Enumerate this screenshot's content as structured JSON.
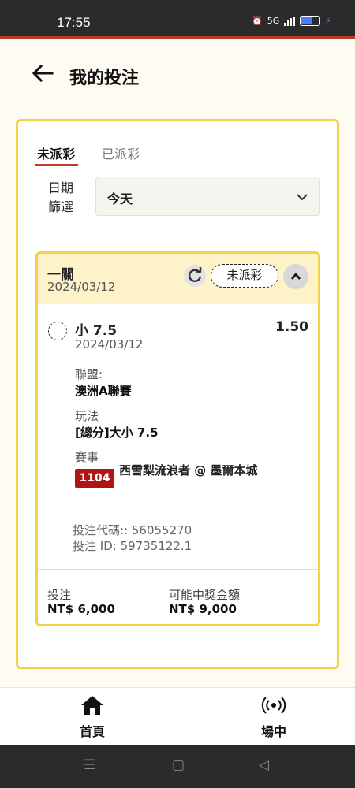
{
  "status_bar": {
    "time": "17:55",
    "network": "5G"
  },
  "header": {
    "title": "我的投注"
  },
  "tabs": [
    {
      "label": "未派彩",
      "active": true
    },
    {
      "label": "已派彩",
      "active": false
    }
  ],
  "filter": {
    "label": "日期篩選",
    "value": "今天"
  },
  "bet": {
    "type": "一關",
    "date": "2024/03/12",
    "status": "未派彩",
    "selection": "小 7.5",
    "odds": "1.50",
    "selection_date": "2024/03/12",
    "league_label": "聯盟:",
    "league": "澳洲A聯賽",
    "market_label": "玩法",
    "market": "[總分]大小 7.5",
    "event_label": "賽事",
    "event_id": "1104",
    "event_name": "西雪梨流浪者 @ 墨爾本城",
    "bet_code": "投注代碼:: 56055270",
    "bet_id": "投注 ID: 59735122.1",
    "stake_label": "投注",
    "stake": "NT$ 6,000",
    "payout_label": "可能中獎金額",
    "payout": "NT$ 9,000"
  },
  "bottom_nav": [
    {
      "label": "首頁",
      "icon": "home-icon"
    },
    {
      "label": "場中",
      "icon": "live-icon"
    }
  ],
  "colors": {
    "accent_red": "#c0392b",
    "border_yellow": "#f3d24a",
    "event_red": "#b01515",
    "header_yellow": "#fdf2c8"
  }
}
